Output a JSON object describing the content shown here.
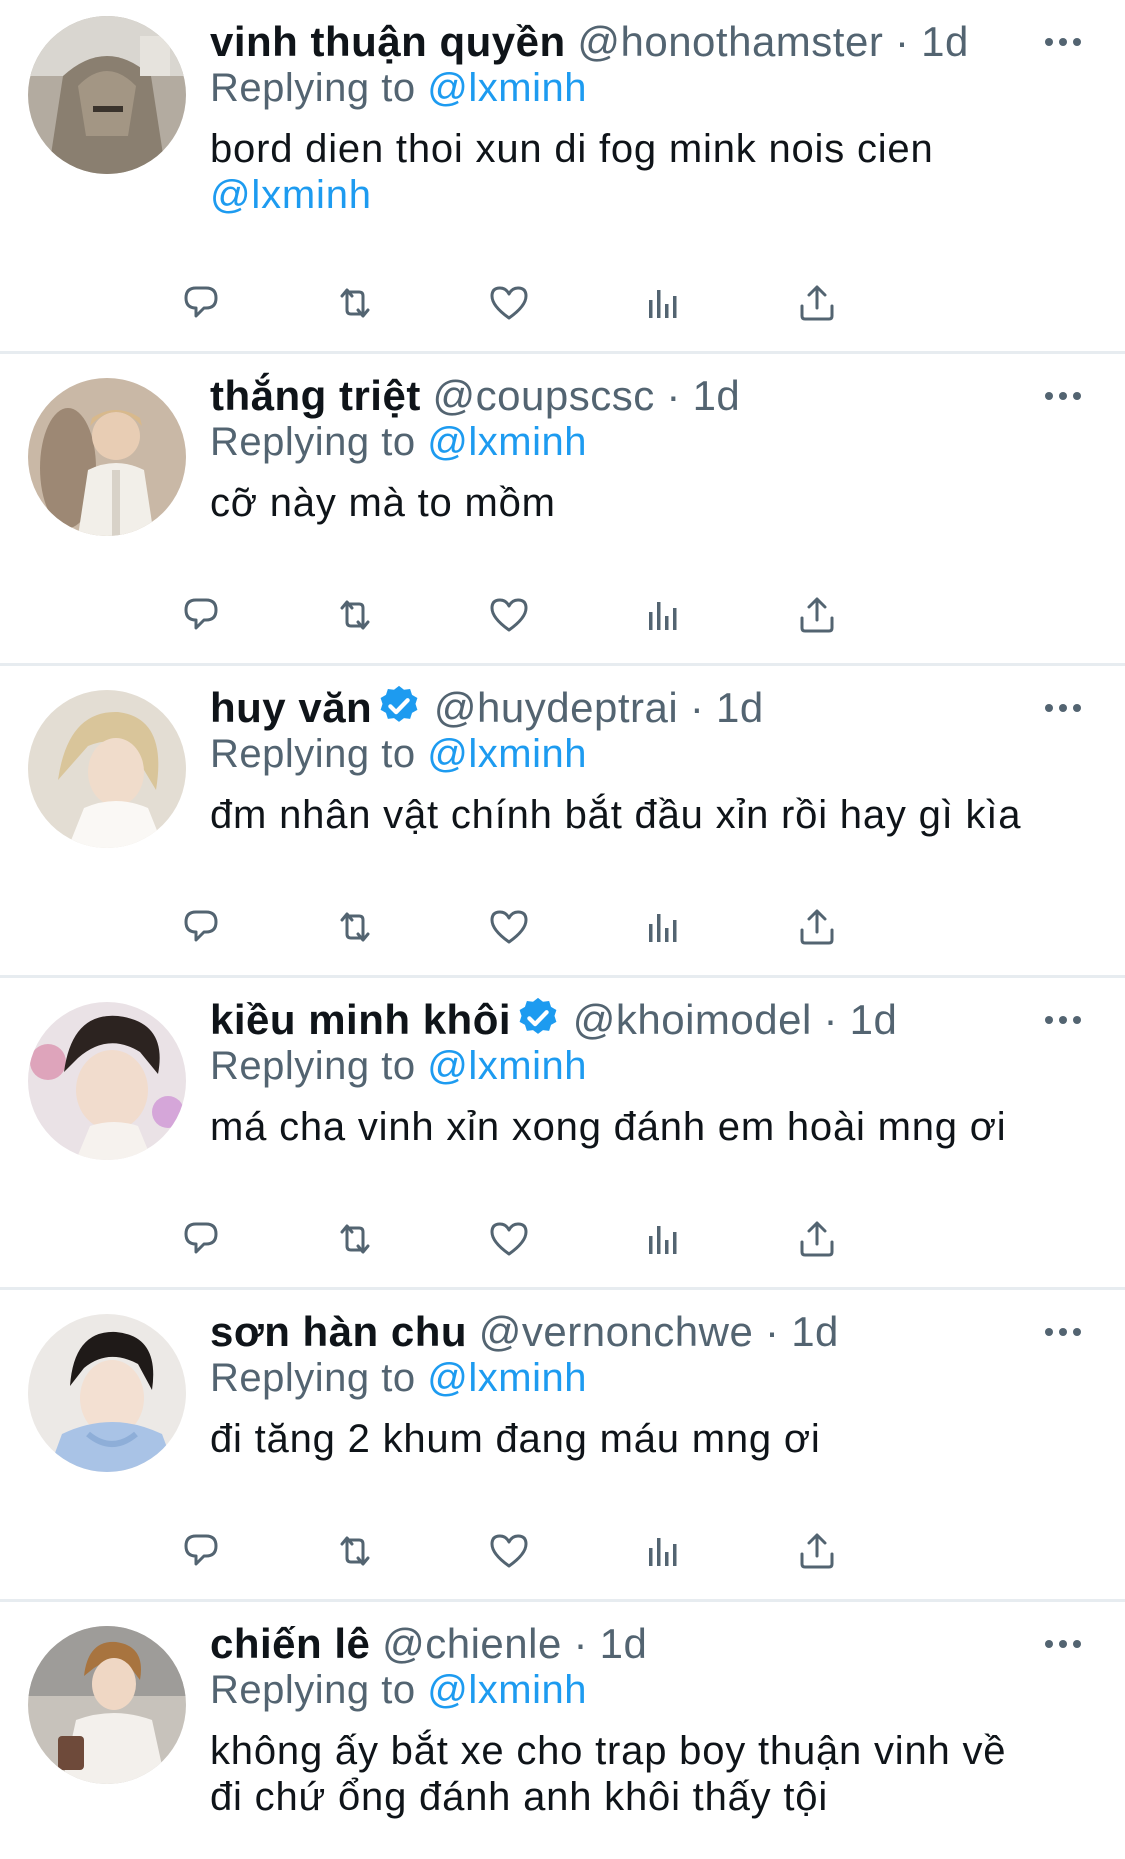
{
  "colors": {
    "text": "#0f1419",
    "secondary": "#536471",
    "link": "#1d9bf0",
    "icon": "#536471",
    "divider": "#e7ecf0"
  },
  "replying_prefix": "Replying to",
  "tweets": [
    {
      "display_name": "vinh thuận quyền",
      "handle": "@honothamster",
      "dot": "·",
      "time": "1d",
      "verified": false,
      "replying_to": "@lxminh",
      "text": "bord dien thoi xun di fog mink nois cien",
      "text_mention": "@lxminh"
    },
    {
      "display_name": "thắng triệt",
      "handle": "@coupscsc",
      "dot": "·",
      "time": "1d",
      "verified": false,
      "replying_to": "@lxminh",
      "text": "cỡ này mà to mồm"
    },
    {
      "display_name": "huy văn",
      "handle": "@huydeptrai",
      "dot": "·",
      "time": "1d",
      "verified": true,
      "replying_to": "@lxminh",
      "text": "đm nhân vật chính bắt đầu xỉn rồi hay gì kìa"
    },
    {
      "display_name": "kiều minh khôi",
      "handle": "@khoimodel",
      "dot": "·",
      "time": "1d",
      "verified": true,
      "replying_to": "@lxminh",
      "text": "má cha vinh xỉn xong đánh em hoài mng ơi"
    },
    {
      "display_name": "sơn hàn chu",
      "handle": "@vernonchwe",
      "dot": "·",
      "time": "1d",
      "verified": false,
      "replying_to": "@lxminh",
      "text": "đi tăng 2 khum đang máu mng ơi"
    },
    {
      "display_name": "chiến lê",
      "handle": "@chienle",
      "dot": "·",
      "time": "1d",
      "verified": false,
      "replying_to": "@lxminh",
      "text": "không ấy bắt xe cho trap boy thuận vinh về",
      "text_line2": "đi chứ ổng đánh anh khôi thấy tội"
    }
  ],
  "icons": {
    "reply": "reply-icon",
    "retweet": "retweet-icon",
    "like": "heart-icon",
    "analytics": "analytics-icon",
    "share": "share-icon",
    "more": "more-icon",
    "verified": "verified-badge-icon"
  }
}
